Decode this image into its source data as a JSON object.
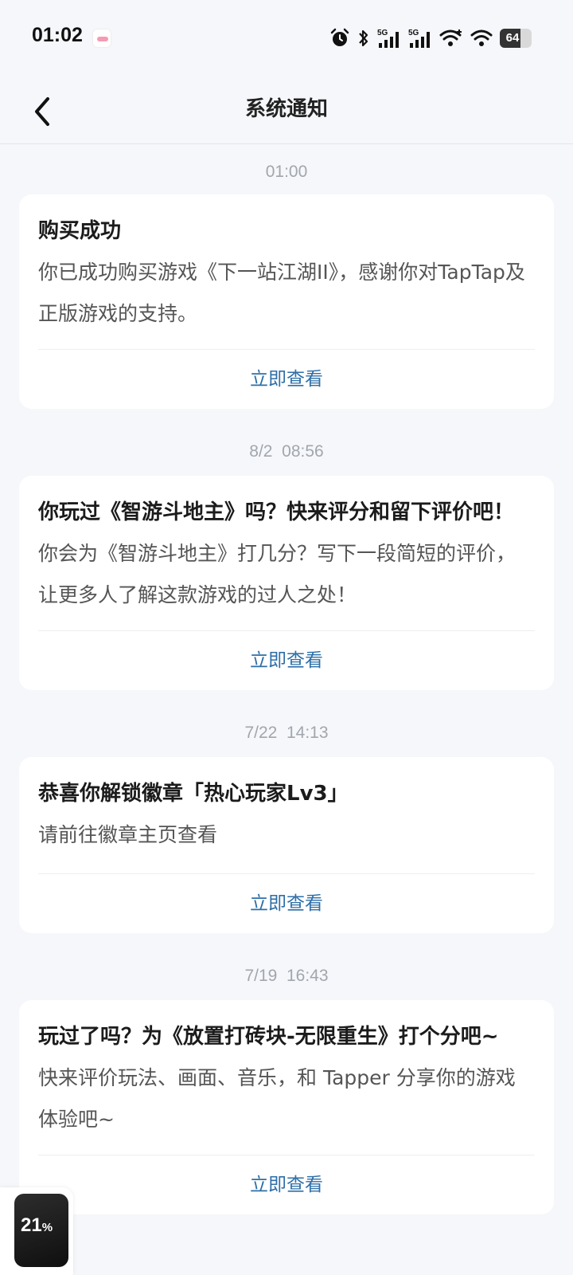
{
  "status_bar": {
    "time": "01:02",
    "battery": "64",
    "icons": [
      "bilibili-app-icon",
      "alarm-icon",
      "bluetooth-icon",
      "signal-5g-icon",
      "signal-5g-icon",
      "wifi-plus-icon",
      "wifi-icon",
      "battery-icon"
    ]
  },
  "nav": {
    "title": "系统通知",
    "back_icon": "chevron-left-icon"
  },
  "notifications": [
    {
      "time": "01:00",
      "title": "购买成功",
      "body": "你已成功购买游戏《下一站江湖II》，感谢你对TapTap及正版游戏的支持。",
      "action": "立即查看"
    },
    {
      "time": "8/2  08:56",
      "title": "你玩过《智游斗地主》吗？快来评分和留下评价吧！",
      "body": "你会为《智游斗地主》打几分？写下一段简短的评价，让更多人了解这款游戏的过人之处！",
      "action": "立即查看"
    },
    {
      "time": "7/22  14:13",
      "title": "恭喜你解锁徽章「热心玩家Lv3」",
      "body": "请前往徽章主页查看",
      "action": "立即查看"
    },
    {
      "time": "7/19  16:43",
      "title": "玩过了吗？为《放置打砖块-无限重生》打个分吧~",
      "body": "快来评价玩法、画面、音乐，和 Tapper 分享你的游戏体验吧~",
      "action": "立即查看"
    }
  ],
  "floating_widget": {
    "value": "21",
    "unit": "%"
  },
  "colors": {
    "background": "#f5f7fa",
    "card": "#ffffff",
    "link": "#2e6fa8",
    "timestamp": "#a2a6ad"
  }
}
